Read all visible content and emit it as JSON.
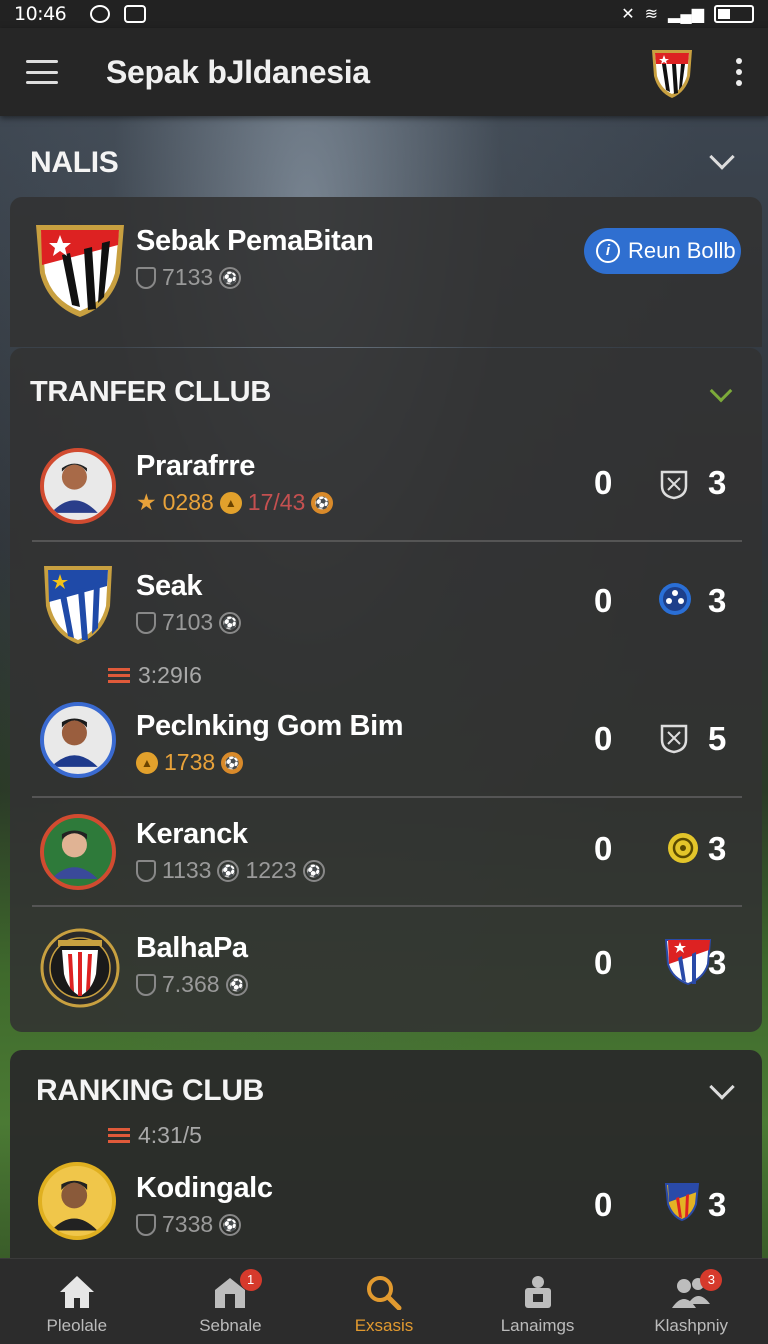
{
  "status_bar": {
    "time": "10:46"
  },
  "app_bar": {
    "title": "Sepak bJldanesia"
  },
  "nalis_section": {
    "title": "NALIS"
  },
  "featured": {
    "name": "Sebak PemaBitan",
    "stat": "7133",
    "button_label": "Reun Bollb"
  },
  "transfer_section": {
    "title": "TRANFER CLLUB",
    "rows": [
      {
        "name": "Prarafrre",
        "stat1": "0288",
        "stat2": "17/43",
        "score_left": "0",
        "score_right": "3"
      },
      {
        "name": "Seak",
        "stat1": "7103",
        "score_left": "0",
        "score_right": "3"
      },
      {
        "name": "Peclnking Gom Bim",
        "stat1": "1738",
        "score_left": "0",
        "score_right": "5"
      },
      {
        "name": "Keranck",
        "stat1": "1133",
        "stat2": "1223",
        "score_left": "0",
        "score_right": "3"
      },
      {
        "name": "BalhaPa",
        "stat1": "7.368",
        "score_left": "0",
        "score_right": "3"
      }
    ],
    "sub_label": "3:29I6"
  },
  "ranking_section": {
    "title": "RANKING CLUB",
    "sub_label": "4:31/5",
    "rows": [
      {
        "name": "Kodingalc",
        "stat1": "7338",
        "score_left": "0",
        "score_right": "3"
      }
    ]
  },
  "bottom_nav": [
    {
      "label": "Pleolale",
      "badge": ""
    },
    {
      "label": "Sebnale",
      "badge": "1"
    },
    {
      "label": "Exsasis",
      "badge": ""
    },
    {
      "label": "Lanaimgs",
      "badge": ""
    },
    {
      "label": "Klashpniy",
      "badge": "3"
    }
  ],
  "colors": {
    "accent": "#e29a2f",
    "button": "#2f6fd0",
    "card": "#323232",
    "badge": "#d63a2c"
  }
}
